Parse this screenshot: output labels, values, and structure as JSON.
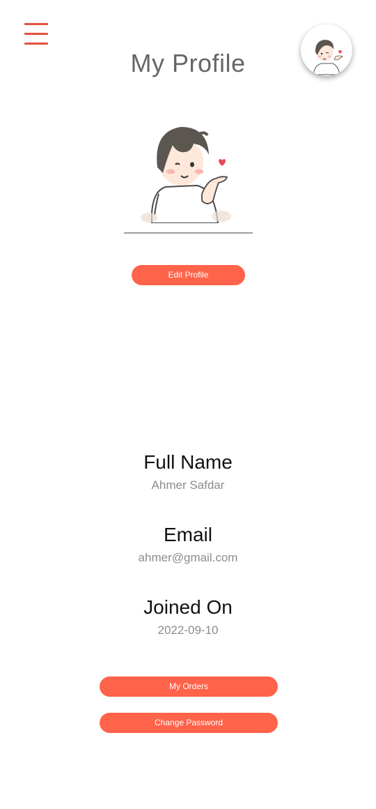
{
  "header": {
    "title": "My Profile",
    "menu_icon": "hamburger-menu-icon",
    "avatar_icon": "avatar-cartoon-boy-icon"
  },
  "profile": {
    "edit_label": "Edit Profile",
    "fields": {
      "full_name": {
        "label": "Full Name",
        "value": "Ahmer Safdar"
      },
      "email": {
        "label": "Email",
        "value": "ahmer@gmail.com"
      },
      "joined": {
        "label": "Joined On",
        "value": "2022-09-10"
      }
    }
  },
  "actions": {
    "orders_label": "My Orders",
    "change_password_label": "Change Password"
  },
  "colors": {
    "accent": "#ff634a",
    "menu_icon": "#e2513d",
    "title": "#666666",
    "value_text": "#8c8c8c"
  }
}
